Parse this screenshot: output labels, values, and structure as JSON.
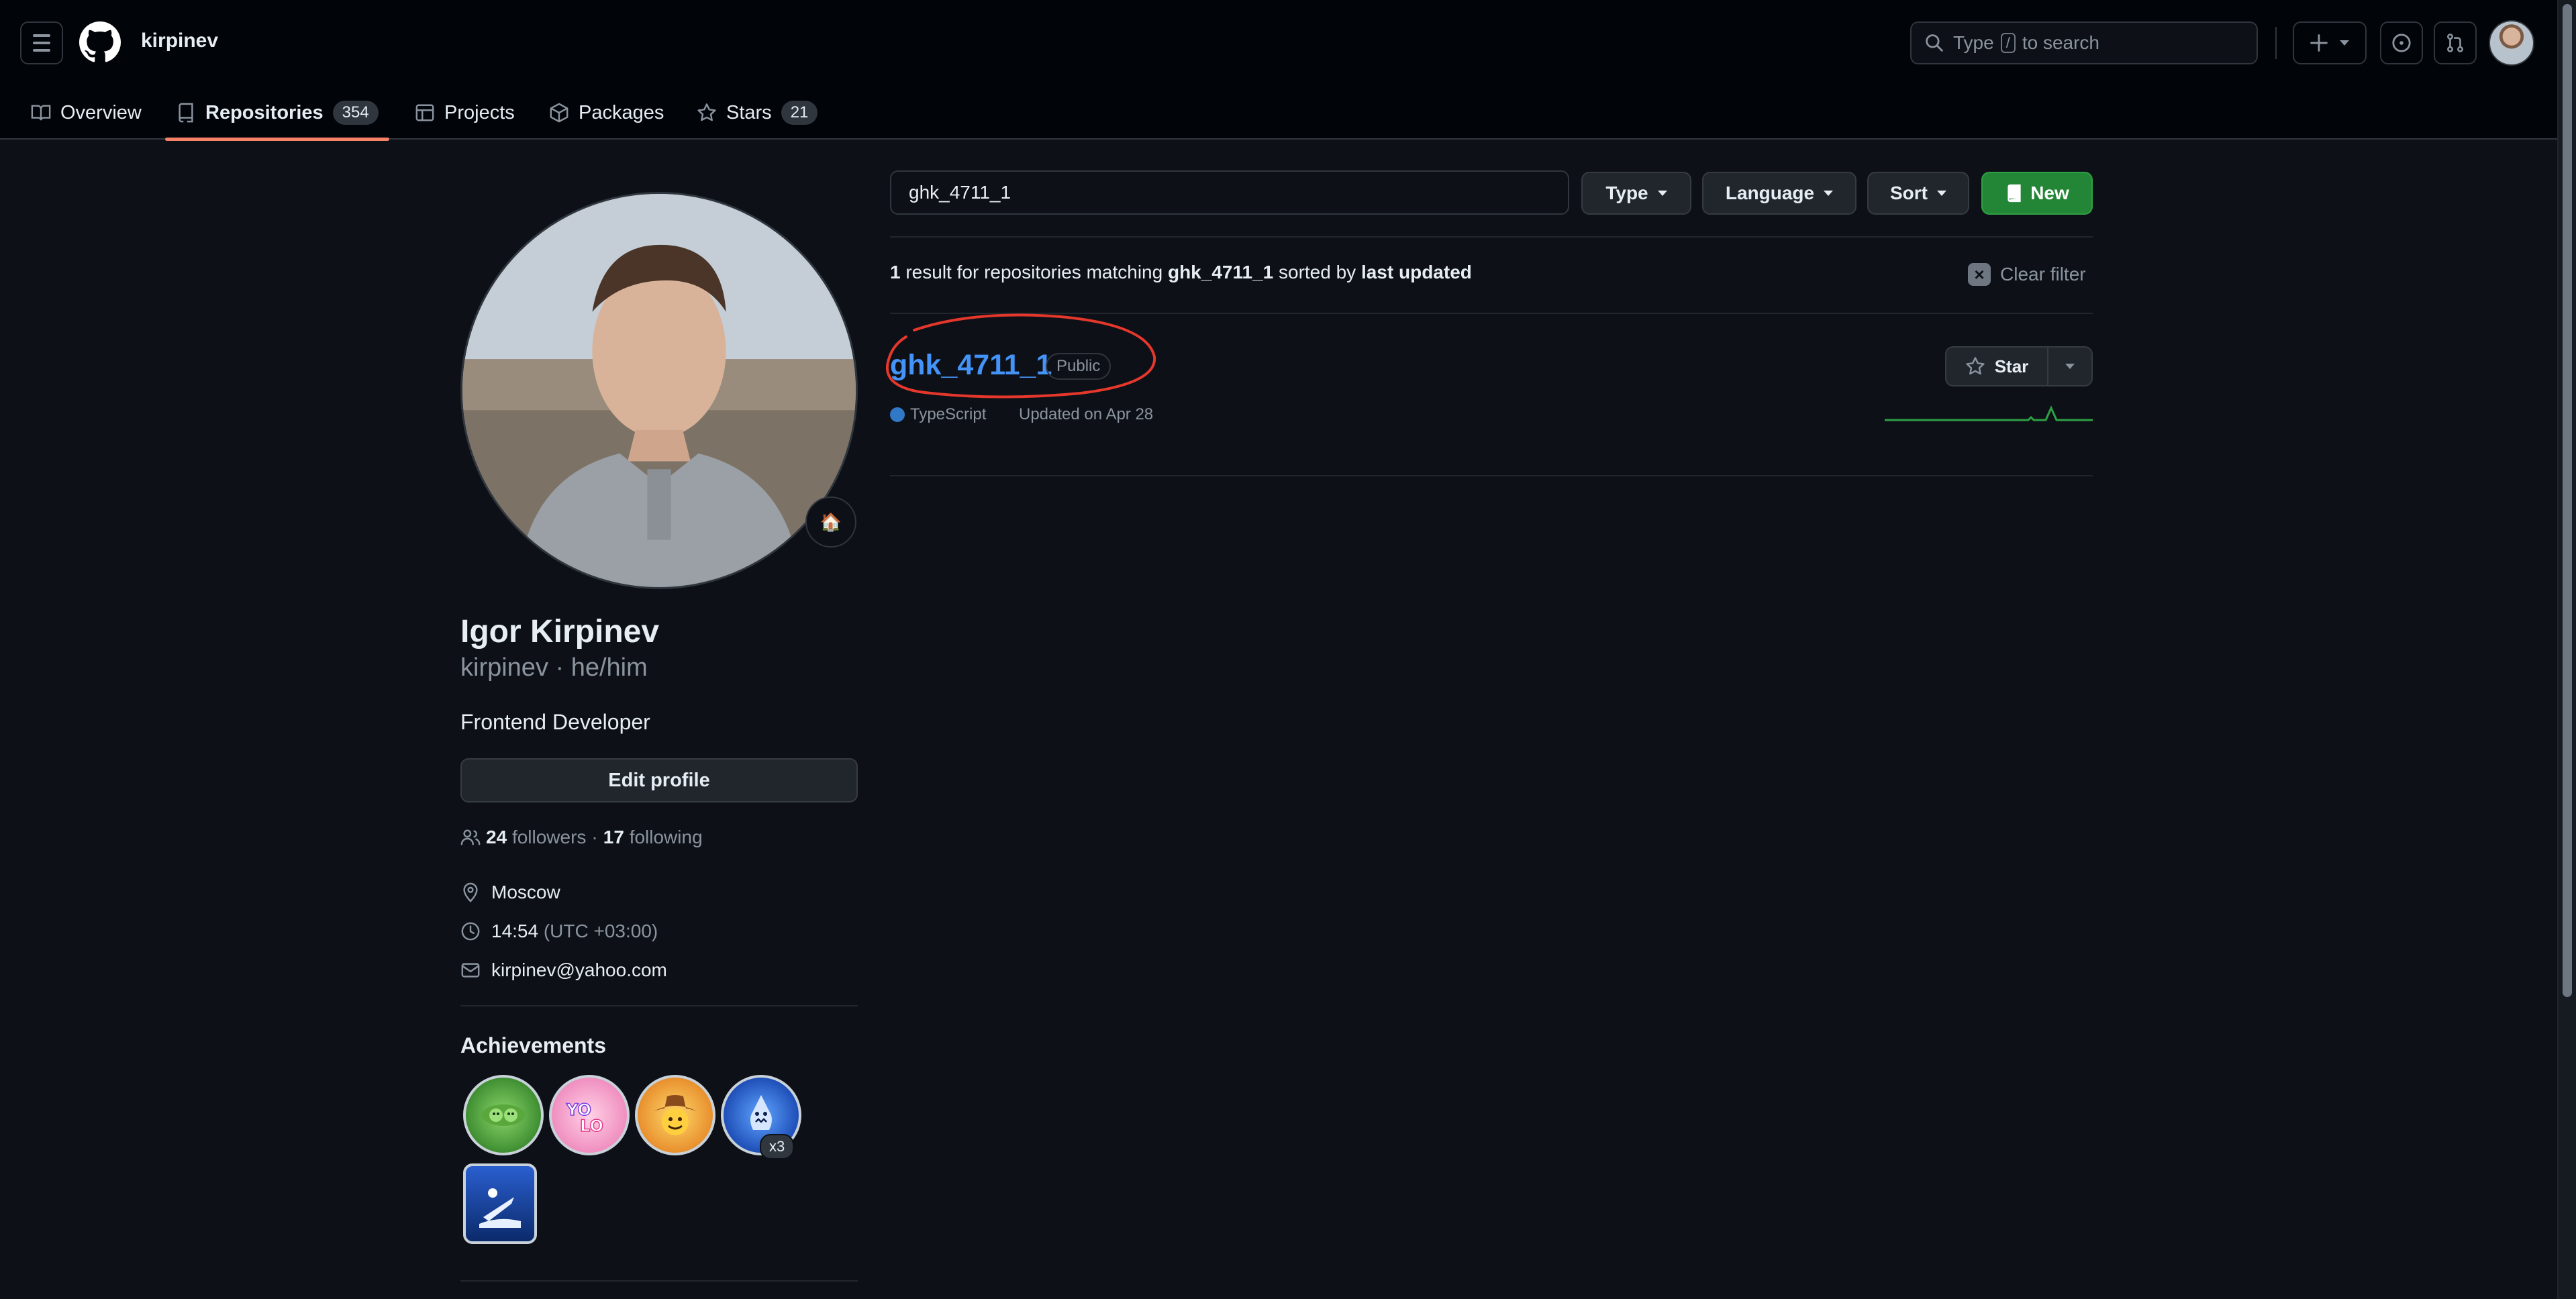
{
  "header": {
    "username": "kirpinev",
    "search_text": "Type",
    "search_key": "/",
    "search_suffix": "to search"
  },
  "tabs": [
    {
      "label": "Overview"
    },
    {
      "label": "Repositories",
      "count": "354"
    },
    {
      "label": "Projects"
    },
    {
      "label": "Packages"
    },
    {
      "label": "Stars",
      "count": "21"
    }
  ],
  "profile": {
    "full_name": "Igor Kirpinev",
    "login_line": "kirpinev · he/him",
    "bio": "Frontend Developer",
    "edit_label": "Edit profile",
    "followers_count": "24",
    "followers_label": "followers",
    "separator": "·",
    "following_count": "17",
    "following_label": "following",
    "location": "Moscow",
    "local_time": "14:54",
    "timezone": "(UTC +03:00)",
    "email": "kirpinev@yahoo.com",
    "status_emoji": "🏠",
    "achievements_title": "Achievements",
    "achievement_multiplier": "x3"
  },
  "filters": {
    "query": "ghk_4711_1",
    "type_label": "Type",
    "language_label": "Language",
    "sort_label": "Sort",
    "new_label": "New"
  },
  "results": {
    "count": "1",
    "text_a": "result for repositories matching",
    "query": "ghk_4711_1",
    "text_b": "sorted by",
    "sort_by": "last updated",
    "clear_label": "Clear filter"
  },
  "repo": {
    "name": "ghk_4711_1",
    "visibility": "Public",
    "language": "TypeScript",
    "language_color": "#3178c6",
    "updated": "Updated on Apr 28",
    "star_label": "Star"
  },
  "colors": {
    "background": "#0d1117",
    "link": "#4493f8",
    "accent_underline": "#f78166",
    "new_button": "#238636",
    "annotation": "#e5372b"
  }
}
